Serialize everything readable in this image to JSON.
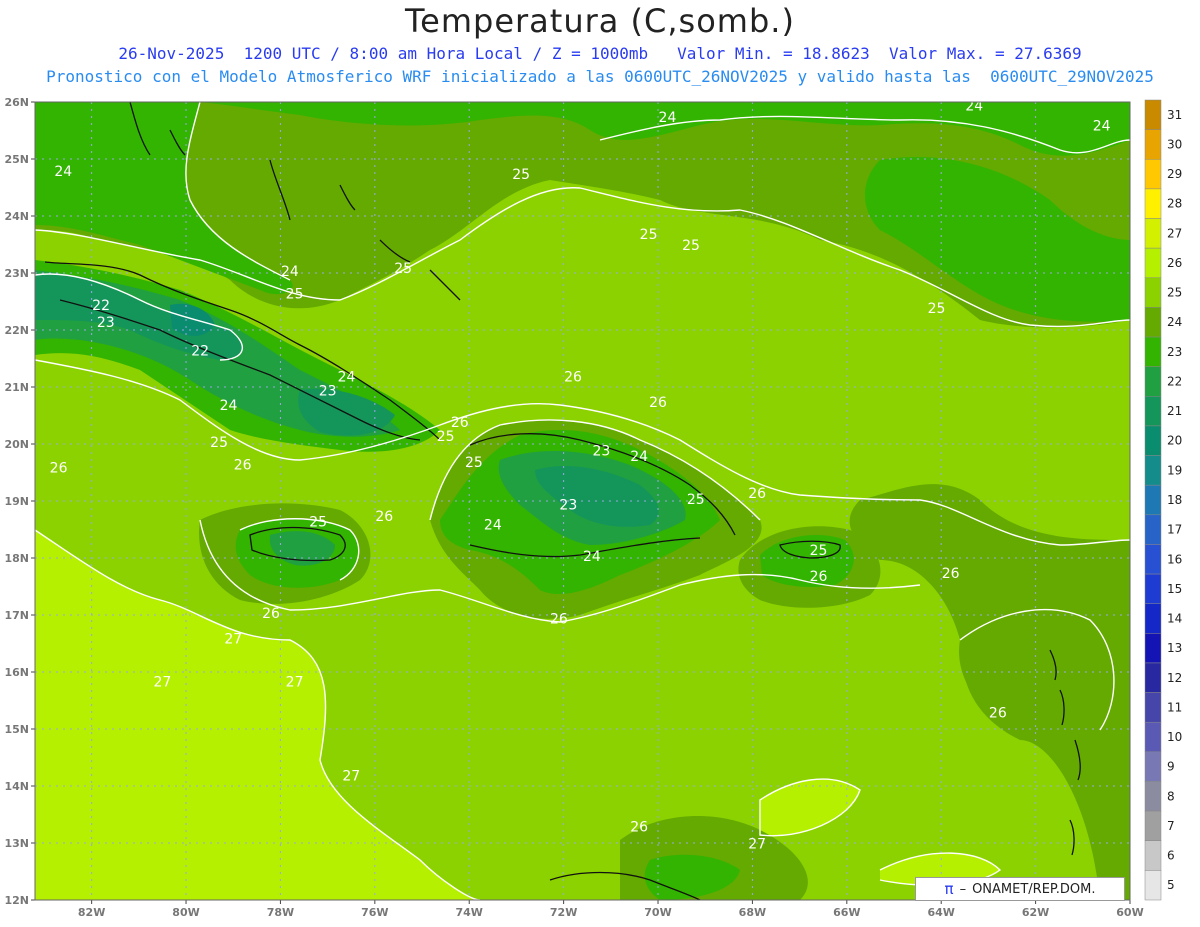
{
  "header": {
    "title": "Temperatura (C,somb.)",
    "line1": "26-Nov-2025  1200 UTC / 8:00 am Hora Local / Z = 1000mb   Valor Min. = 18.8623  Valor Max. = 27.6369",
    "line2": "Pronostico con el Modelo Atmosferico WRF inicializado a las 0600UTC_26NOV2025 y valido hasta las  0600UTC_29NOV2025"
  },
  "axes": {
    "lat_labels": [
      "26N",
      "25N",
      "24N",
      "23N",
      "22N",
      "21N",
      "20N",
      "19N",
      "18N",
      "17N",
      "16N",
      "15N",
      "14N",
      "13N",
      "12N"
    ],
    "lon_labels": [
      "82W",
      "80W",
      "78W",
      "76W",
      "74W",
      "72W",
      "70W",
      "68W",
      "66W",
      "64W",
      "62W",
      "60W"
    ]
  },
  "colorbar": {
    "labels": [
      "31",
      "30",
      "29",
      "28",
      "27",
      "26",
      "25",
      "24",
      "23",
      "22",
      "21",
      "20",
      "19",
      "18",
      "17",
      "16",
      "15",
      "14",
      "13",
      "12",
      "11",
      "10",
      "9",
      "8",
      "7",
      "6",
      "5"
    ],
    "colors": [
      "#c98a00",
      "#e8a400",
      "#ffc800",
      "#fff000",
      "#d2f000",
      "#b4f000",
      "#8cd200",
      "#64aa00",
      "#32b400",
      "#20a040",
      "#14965a",
      "#0a8c6e",
      "#148c8c",
      "#1e78b4",
      "#2864c8",
      "#2850d2",
      "#1e3cd2",
      "#1428c8",
      "#1414b4",
      "#2828a0",
      "#4646aa",
      "#5a5ab4",
      "#7878b4",
      "#8c8ca0",
      "#a0a0a0",
      "#c8c8c8",
      "#e6e6e6"
    ]
  },
  "contour_labels": [
    {
      "t": "24",
      "lon": -69.8,
      "lat": 25.65
    },
    {
      "t": "24",
      "lon": -63.3,
      "lat": 25.85
    },
    {
      "t": "24",
      "lon": -60.6,
      "lat": 25.5
    },
    {
      "t": "24",
      "lon": -82.6,
      "lat": 24.7
    },
    {
      "t": "25",
      "lon": -72.9,
      "lat": 24.65
    },
    {
      "t": "25",
      "lon": -70.2,
      "lat": 23.6
    },
    {
      "t": "25",
      "lon": -69.3,
      "lat": 23.4
    },
    {
      "t": "24",
      "lon": -77.8,
      "lat": 22.95
    },
    {
      "t": "25",
      "lon": -75.4,
      "lat": 23.0
    },
    {
      "t": "25",
      "lon": -77.7,
      "lat": 22.55
    },
    {
      "t": "25",
      "lon": -64.1,
      "lat": 22.3
    },
    {
      "t": "22",
      "lon": -81.8,
      "lat": 22.35
    },
    {
      "t": "23",
      "lon": -81.7,
      "lat": 22.05
    },
    {
      "t": "22",
      "lon": -79.7,
      "lat": 21.55
    },
    {
      "t": "26",
      "lon": -71.8,
      "lat": 21.1
    },
    {
      "t": "24",
      "lon": -76.6,
      "lat": 21.1
    },
    {
      "t": "23",
      "lon": -77.0,
      "lat": 20.85
    },
    {
      "t": "26",
      "lon": -70.0,
      "lat": 20.65
    },
    {
      "t": "24",
      "lon": -79.1,
      "lat": 20.6
    },
    {
      "t": "26",
      "lon": -74.2,
      "lat": 20.3
    },
    {
      "t": "25",
      "lon": -74.5,
      "lat": 20.05
    },
    {
      "t": "25",
      "lon": -79.3,
      "lat": 19.95
    },
    {
      "t": "23",
      "lon": -71.2,
      "lat": 19.8
    },
    {
      "t": "24",
      "lon": -70.4,
      "lat": 19.7
    },
    {
      "t": "26",
      "lon": -82.7,
      "lat": 19.5
    },
    {
      "t": "26",
      "lon": -78.8,
      "lat": 19.55
    },
    {
      "t": "25",
      "lon": -73.9,
      "lat": 19.6
    },
    {
      "t": "26",
      "lon": -67.9,
      "lat": 19.05
    },
    {
      "t": "25",
      "lon": -69.2,
      "lat": 18.95
    },
    {
      "t": "23",
      "lon": -71.9,
      "lat": 18.85
    },
    {
      "t": "26",
      "lon": -75.8,
      "lat": 18.65
    },
    {
      "t": "25",
      "lon": -77.2,
      "lat": 18.55
    },
    {
      "t": "24",
      "lon": -73.5,
      "lat": 18.5
    },
    {
      "t": "24",
      "lon": -71.4,
      "lat": 17.95
    },
    {
      "t": "25",
      "lon": -66.6,
      "lat": 18.05
    },
    {
      "t": "26",
      "lon": -66.6,
      "lat": 17.6
    },
    {
      "t": "26",
      "lon": -63.8,
      "lat": 17.65
    },
    {
      "t": "26",
      "lon": -78.2,
      "lat": 16.95
    },
    {
      "t": "26",
      "lon": -72.1,
      "lat": 16.85
    },
    {
      "t": "27",
      "lon": -79.0,
      "lat": 16.5
    },
    {
      "t": "27",
      "lon": -80.5,
      "lat": 15.75
    },
    {
      "t": "27",
      "lon": -77.7,
      "lat": 15.75
    },
    {
      "t": "26",
      "lon": -62.8,
      "lat": 15.2
    },
    {
      "t": "27",
      "lon": -76.5,
      "lat": 14.1
    },
    {
      "t": "26",
      "lon": -70.4,
      "lat": 13.2
    },
    {
      "t": "27",
      "lon": -67.9,
      "lat": 12.9
    }
  ],
  "credit": {
    "symbol": "π",
    "text": "ONAMET/REP.DOM."
  }
}
